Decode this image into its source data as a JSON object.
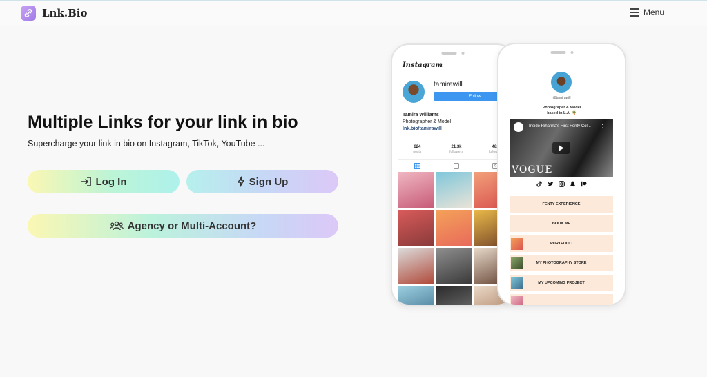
{
  "header": {
    "brand": "Lnk.Bio",
    "menu_label": "Menu"
  },
  "hero": {
    "title": "Multiple Links for your link in bio",
    "subtitle": "Supercharge your link in bio on Instagram, TikTok, YouTube ...",
    "login_label": "Log In",
    "signup_label": "Sign Up",
    "agency_label": "Agency or Multi-Account?"
  },
  "instagram_preview": {
    "wordmark": "Instagram",
    "username": "tamirawill",
    "follow_label": "Follow",
    "name": "Tamira Williams",
    "role": "Photographer & Model",
    "link": "lnk.bio/tamirawill",
    "stats": [
      {
        "value": "624",
        "label": "posts"
      },
      {
        "value": "21.3k",
        "label": "followers"
      },
      {
        "value": "482",
        "label": "following"
      }
    ]
  },
  "lnkbio_preview": {
    "handle": "@tamirawill",
    "desc_line1": "Photograper & Model",
    "desc_line2": "based in L.A. 🌴",
    "video_title": "Inside Rihanna's First Fenty Col...",
    "video_watermark": "VOGUE",
    "buttons": [
      "FENTY EXPERIENCE",
      "BOOK ME",
      "PORTFOLIO",
      "MY PHOTOGRAPHY STORE",
      "MY UPCOMING PROJECT"
    ]
  },
  "colors": {
    "brand_purple": "#a884ea",
    "instagram_blue": "#3d97f0",
    "link_button_peach": "#fde9d9"
  }
}
